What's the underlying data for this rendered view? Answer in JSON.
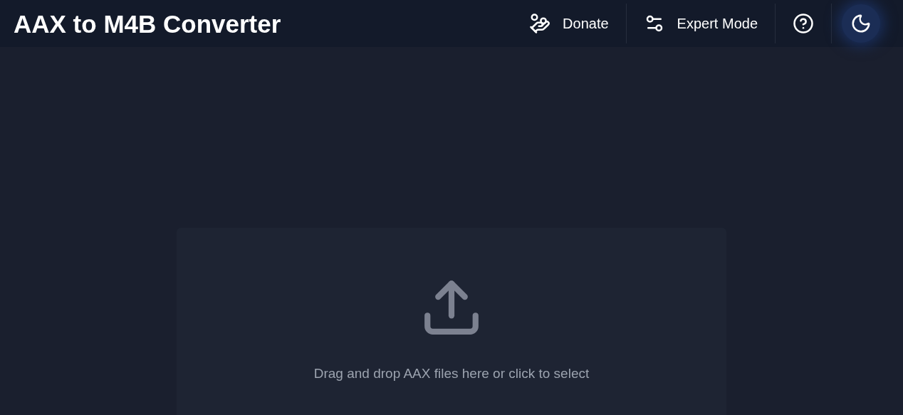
{
  "header": {
    "title": "AAX to M4B Converter",
    "actions": [
      {
        "kind": "donate",
        "label": "Donate"
      },
      {
        "kind": "expert",
        "label": "Expert Mode"
      },
      {
        "kind": "help"
      }
    ],
    "dark_mode_toggle": {
      "on": true
    }
  },
  "dropzone": {
    "text": "Drag and drop AAX files here or click to select"
  }
}
